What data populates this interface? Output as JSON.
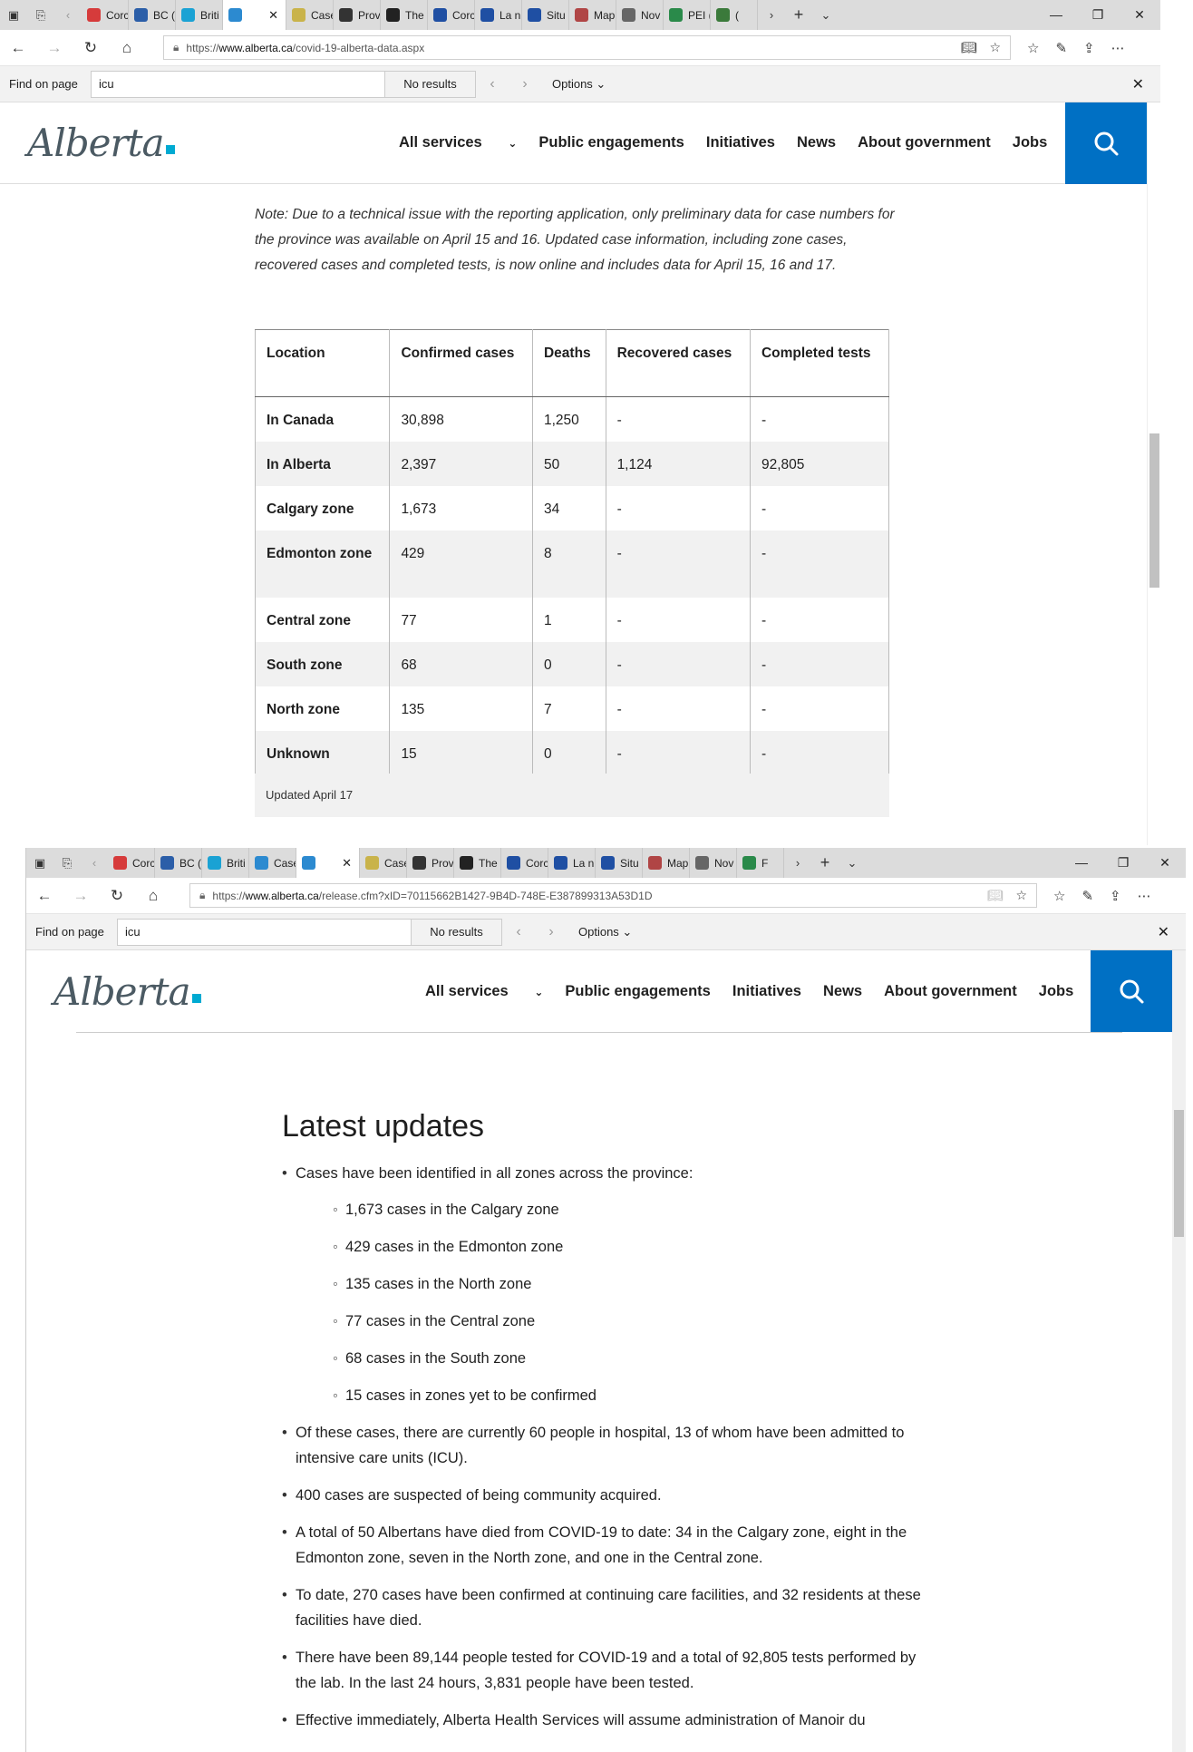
{
  "colors": {
    "brand_blue": "#0070c4",
    "logo_square": "#00aad2"
  },
  "window1": {
    "tabs": [
      {
        "label": "Corc",
        "color": "#d63b3b"
      },
      {
        "label": "BC (",
        "color": "#2b5ea8"
      },
      {
        "label": "Briti",
        "color": "#1aa2d4"
      },
      {
        "label": "",
        "color": "#2c8ad0",
        "active": true
      },
      {
        "label": "Case",
        "color": "#c9b34a"
      },
      {
        "label": "Prov",
        "color": "#333333"
      },
      {
        "label": "The",
        "color": "#222222"
      },
      {
        "label": "Corc",
        "color": "#1f4fa3"
      },
      {
        "label": "La n",
        "color": "#1f4fa3"
      },
      {
        "label": "Situ",
        "color": "#1f4fa3"
      },
      {
        "label": "Map",
        "color": "#b04545"
      },
      {
        "label": "Nov",
        "color": "#666666"
      },
      {
        "label": "PEI (",
        "color": "#2a8a4a"
      },
      {
        "label": "(",
        "color": "#3b7a3b"
      }
    ],
    "url_prefix": "https://",
    "url_host": "www.alberta.ca",
    "url_path": "/covid-19-alberta-data.aspx",
    "find": {
      "label": "Find on page",
      "value": "icu",
      "results": "No results",
      "options": "Options"
    },
    "note": "Note: Due to a technical issue with the reporting application, only preliminary data for case numbers for the province was available on April 15 and 16. Updated case information, including zone cases, recovered cases and completed tests, is now online and includes data for April 15, 16 and 17.",
    "table": {
      "headers": [
        "Location",
        "Confirmed cases",
        "Deaths",
        "Recovered cases",
        "Completed tests"
      ],
      "rows": [
        [
          "In Canada",
          "30,898",
          "1,250",
          "-",
          "-"
        ],
        [
          "In Alberta",
          "2,397",
          "50",
          "1,124",
          "92,805"
        ],
        [
          "Calgary zone",
          "1,673",
          "34",
          "-",
          "-"
        ],
        [
          "Edmonton zone",
          "429",
          "8",
          "-",
          "-"
        ],
        [
          "Central zone",
          "77",
          "1",
          "-",
          "-"
        ],
        [
          "South zone",
          "68",
          "0",
          "-",
          "-"
        ],
        [
          "North zone",
          "135",
          "7",
          "-",
          "-"
        ],
        [
          "Unknown",
          "15",
          "0",
          "-",
          "-"
        ]
      ],
      "caption": "Updated April 17"
    }
  },
  "window2": {
    "tabs": [
      {
        "label": "Corc",
        "color": "#d63b3b"
      },
      {
        "label": "BC (",
        "color": "#2b5ea8"
      },
      {
        "label": "Briti",
        "color": "#1aa2d4"
      },
      {
        "label": "Case",
        "color": "#2c8ad0"
      },
      {
        "label": "",
        "color": "#2c8ad0",
        "active": true
      },
      {
        "label": "Case",
        "color": "#c9b34a"
      },
      {
        "label": "Prov",
        "color": "#333333"
      },
      {
        "label": "The",
        "color": "#222222"
      },
      {
        "label": "Corc",
        "color": "#1f4fa3"
      },
      {
        "label": "La n",
        "color": "#1f4fa3"
      },
      {
        "label": "Situ",
        "color": "#1f4fa3"
      },
      {
        "label": "Map",
        "color": "#b04545"
      },
      {
        "label": "Nov",
        "color": "#666666"
      },
      {
        "label": "F",
        "color": "#2a8a4a"
      }
    ],
    "url_prefix": "https://",
    "url_host": "www.alberta.ca",
    "url_path": "/release.cfm?xID=70115662B1427-9B4D-748E-E387899313A53D1D",
    "find": {
      "label": "Find on page",
      "value": "icu",
      "results": "No results",
      "options": "Options"
    },
    "heading": "Latest updates",
    "bullets": [
      {
        "text": "Cases have been identified in all zones across the province:",
        "sub": [
          "1,673 cases in the Calgary zone",
          "429 cases in the Edmonton zone",
          "135 cases in the North zone",
          "77 cases in the Central zone",
          "68 cases in the South zone",
          "15 cases in zones yet to be confirmed"
        ]
      },
      {
        "text": "Of these cases, there are currently 60 people in hospital, 13 of whom have been admitted to intensive care units (ICU)."
      },
      {
        "text": "400 cases are suspected of being community acquired."
      },
      {
        "text": "A total of 50 Albertans have died from COVID-19 to date: 34 in the Calgary zone, eight in the Edmonton zone, seven in the North zone, and one in the Central zone."
      },
      {
        "text": "To date, 270 cases have been confirmed at continuing care facilities, and 32 residents at these facilities have died."
      },
      {
        "text": "There have been 89,144 people tested for COVID-19 and a total of 92,805 tests performed by the lab. In the last 24 hours, 3,831 people have been tested."
      },
      {
        "text": "Effective immediately, Alberta Health Services will assume administration of Manoir du"
      }
    ]
  },
  "site": {
    "logo": "Alberta",
    "nav": [
      "All services",
      "Public engagements",
      "Initiatives",
      "News",
      "About government",
      "Jobs"
    ]
  }
}
